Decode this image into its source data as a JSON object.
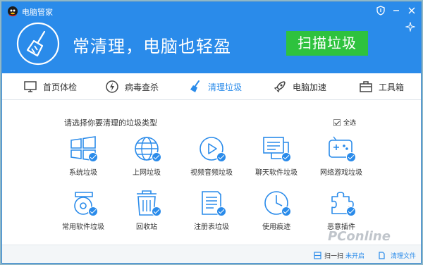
{
  "app": {
    "title": "电脑管家"
  },
  "banner": {
    "slogan": "常清理，电脑也轻盈",
    "scan_button": "扫描垃圾"
  },
  "tabs": [
    {
      "label": "首页体检",
      "icon": "monitor-icon"
    },
    {
      "label": "病毒查杀",
      "icon": "lightning-shield-icon"
    },
    {
      "label": "清理垃圾",
      "icon": "broom-icon",
      "active": true
    },
    {
      "label": "电脑加速",
      "icon": "rocket-icon"
    },
    {
      "label": "工具箱",
      "icon": "toolbox-icon"
    }
  ],
  "section": {
    "title": "请选择你要清理的垃圾类型",
    "select_all": "全选",
    "select_all_checked": true
  },
  "items": [
    {
      "label": "系统垃圾",
      "icon": "windows-icon",
      "checked": true
    },
    {
      "label": "上网垃圾",
      "icon": "globe-icon",
      "checked": true
    },
    {
      "label": "视频音频垃圾",
      "icon": "play-icon",
      "checked": true
    },
    {
      "label": "聊天软件垃圾",
      "icon": "chat-icon",
      "checked": true
    },
    {
      "label": "网络游戏垃圾",
      "icon": "gamepad-icon",
      "checked": true
    },
    {
      "label": "常用软件垃圾",
      "icon": "disc-icon",
      "checked": true
    },
    {
      "label": "回收站",
      "icon": "trash-icon",
      "checked": true
    },
    {
      "label": "注册表垃圾",
      "icon": "registry-icon",
      "checked": true
    },
    {
      "label": "使用痕迹",
      "icon": "clock-icon",
      "checked": true
    },
    {
      "label": "恶意插件",
      "icon": "puzzle-icon",
      "checked": true
    }
  ],
  "footer": {
    "scan_label": "扫一扫",
    "scan_status": "未开启",
    "clean_file": "清理文件"
  },
  "watermark": "PConline",
  "colors": {
    "primary": "#2a8bea",
    "scan_button": "#2ec23e"
  }
}
